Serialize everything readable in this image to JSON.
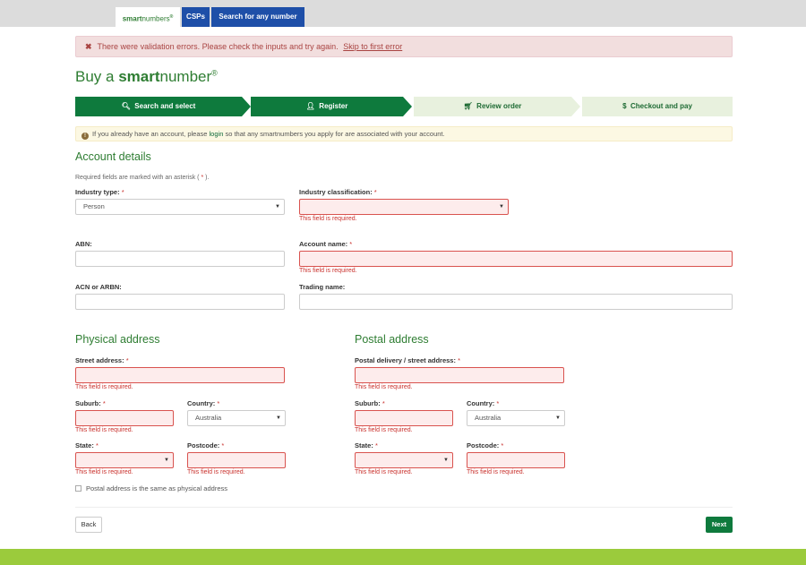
{
  "topnav": {
    "logo_bold": "smart",
    "logo_light": "numbers",
    "logo_reg": "®",
    "tabs": [
      {
        "label": "CSPs"
      },
      {
        "label": "Search for any number"
      }
    ]
  },
  "error_alert": {
    "icon": "✖",
    "text": "There were validation errors. Please check the inputs and try again.",
    "link": "Skip to first error"
  },
  "page_title": {
    "prefix": "Buy a ",
    "bold": "smart",
    "suffix": "number",
    "reg": "®"
  },
  "steps": [
    {
      "icon": "search-icon",
      "glyph": "🔍︎",
      "label": "Search and select",
      "state": "done"
    },
    {
      "icon": "user-icon",
      "glyph": "👤︎",
      "label": "Register",
      "state": "done"
    },
    {
      "icon": "cart-icon",
      "glyph": "🛒︎",
      "label": "Review order",
      "state": "todo"
    },
    {
      "icon": "dollar-icon",
      "glyph": "$",
      "label": "Checkout and pay",
      "state": "todo"
    }
  ],
  "info_alert": {
    "icon": "!",
    "before": "If you already have an account, please",
    "link": "login",
    "after": "so that any smartnumbers you apply for are associated with your account."
  },
  "account": {
    "heading": "Account details",
    "required_note_before": "Required fields are marked with an asterisk (",
    "required_note_star": "*",
    "required_note_after": ").",
    "industry_type": {
      "label": "Industry type:",
      "value": "Person"
    },
    "industry_classification": {
      "label": "Industry classification:",
      "value": ""
    },
    "abn": {
      "label": "ABN:",
      "value": ""
    },
    "account_name": {
      "label": "Account name:",
      "value": ""
    },
    "acn": {
      "label": "ACN or ARBN:",
      "value": ""
    },
    "trading_name": {
      "label": "Trading name:",
      "value": ""
    }
  },
  "physical": {
    "heading": "Physical address",
    "street": {
      "label": "Street address:",
      "value": ""
    },
    "suburb": {
      "label": "Suburb:",
      "value": ""
    },
    "country": {
      "label": "Country:",
      "value": "Australia"
    },
    "state": {
      "label": "State:",
      "value": ""
    },
    "postcode": {
      "label": "Postcode:",
      "value": ""
    }
  },
  "postal": {
    "heading": "Postal address",
    "street": {
      "label": "Postal delivery / street address:",
      "value": ""
    },
    "suburb": {
      "label": "Suburb:",
      "value": ""
    },
    "country": {
      "label": "Country:",
      "value": "Australia"
    },
    "state": {
      "label": "State:",
      "value": ""
    },
    "postcode": {
      "label": "Postcode:",
      "value": ""
    }
  },
  "required_star": "*",
  "error_required": "This field is required.",
  "same_address_label": "Postal address is the same as physical address",
  "buttons": {
    "back": "Back",
    "next": "Next"
  },
  "colors": {
    "brand_green": "#0e7a3d",
    "error_red": "#c9302c",
    "nav_blue": "#1e4fa8",
    "footer_green": "#9bcb3c"
  }
}
